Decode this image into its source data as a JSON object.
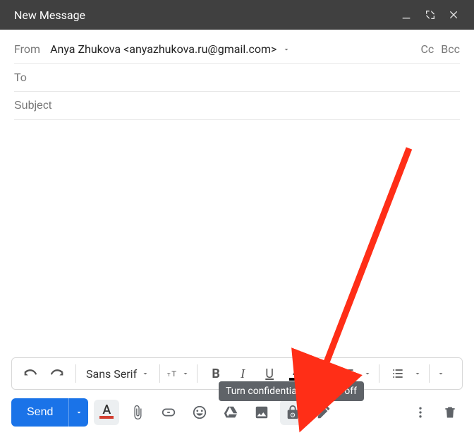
{
  "title": "New Message",
  "from": {
    "label": "From",
    "display": "Anya Zhukova <anyazhukova.ru@gmail.com>"
  },
  "cc_label": "Cc",
  "bcc_label": "Bcc",
  "to": {
    "label": "To",
    "value": ""
  },
  "subject": {
    "placeholder": "Subject",
    "value": ""
  },
  "format": {
    "font": "Sans Serif"
  },
  "tooltip": "Turn confidential mode on/off",
  "send_label": "Send"
}
